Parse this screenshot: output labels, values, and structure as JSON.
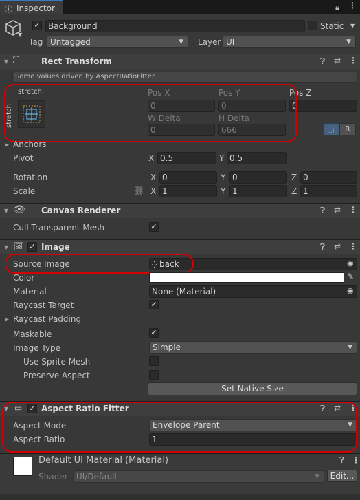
{
  "tab": {
    "title": "Inspector"
  },
  "object": {
    "name": "Background",
    "static_label": "Static",
    "tag_label": "Tag",
    "tag_value": "Untagged",
    "layer_label": "Layer",
    "layer_value": "UI"
  },
  "rect_transform": {
    "title": "Rect Transform",
    "info": "Some values driven by AspectRatioFitter.",
    "anchor_top_label": "stretch",
    "anchor_side_label": "stretch",
    "pos_x_label": "Pos X",
    "pos_x": "0",
    "pos_y_label": "Pos Y",
    "pos_y": "0",
    "pos_z_label": "Pos Z",
    "pos_z": "0",
    "w_delta_label": "W Delta",
    "w_delta": "0",
    "h_delta_label": "H Delta",
    "h_delta": "666",
    "raw_label": "R",
    "anchors_label": "Anchors",
    "pivot_label": "Pivot",
    "pivot_x": "0.5",
    "pivot_y": "0.5",
    "rotation_label": "Rotation",
    "rot_x": "0",
    "rot_y": "0",
    "rot_z": "0",
    "scale_label": "Scale",
    "scale_x": "1",
    "scale_y": "1",
    "scale_z": "1",
    "x": "X",
    "y": "Y",
    "z": "Z"
  },
  "canvas_renderer": {
    "title": "Canvas Renderer",
    "cull_label": "Cull Transparent Mesh",
    "cull_checked": true
  },
  "image": {
    "title": "Image",
    "source_label": "Source Image",
    "source_value": "back",
    "color_label": "Color",
    "color_value": "#ffffff",
    "material_label": "Material",
    "material_value": "None (Material)",
    "raycast_target_label": "Raycast Target",
    "raycast_padding_label": "Raycast Padding",
    "maskable_label": "Maskable",
    "image_type_label": "Image Type",
    "image_type_value": "Simple",
    "use_sprite_mesh_label": "Use Sprite Mesh",
    "preserve_aspect_label": "Preserve Aspect",
    "set_native_size_label": "Set Native Size"
  },
  "aspect_ratio_fitter": {
    "title": "Aspect Ratio Fitter",
    "mode_label": "Aspect Mode",
    "mode_value": "Envelope Parent",
    "ratio_label": "Aspect Ratio",
    "ratio_value": "1"
  },
  "material_footer": {
    "title": "Default UI Material (Material)",
    "shader_label": "Shader",
    "shader_value": "UI/Default",
    "edit_label": "Edit..."
  },
  "colors": {
    "highlight": "#d20000",
    "accent_tab": "#3a79bb"
  }
}
